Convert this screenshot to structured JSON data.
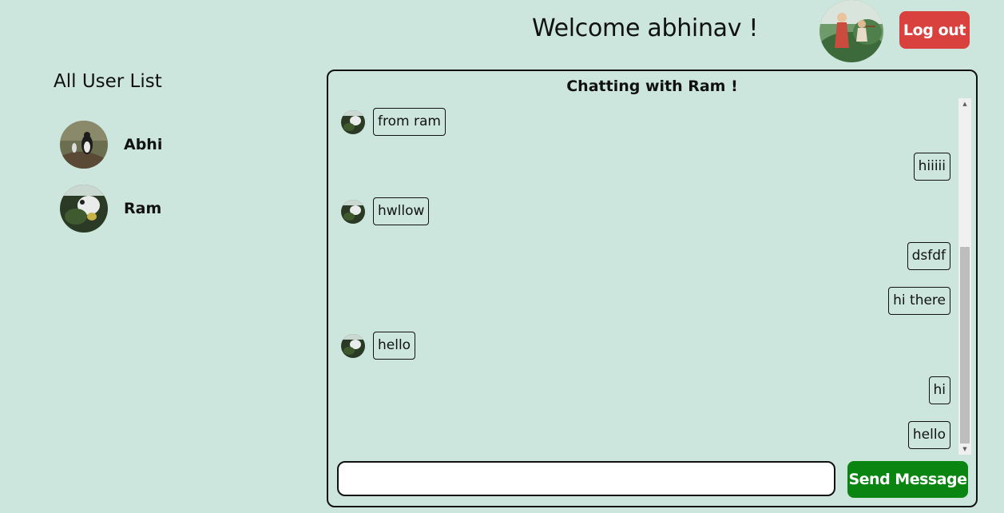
{
  "header": {
    "welcome_text": "Welcome abhinav !",
    "logout_label": "Log out"
  },
  "sidebar": {
    "title": "All User List",
    "users": [
      {
        "name": "Abhi"
      },
      {
        "name": "Ram"
      }
    ]
  },
  "chat": {
    "title": "Chatting with Ram !",
    "messages": [
      {
        "side": "left",
        "text": "from ram"
      },
      {
        "side": "right",
        "text": "hiiiii"
      },
      {
        "side": "left",
        "text": "hwllow"
      },
      {
        "side": "right",
        "text": "dsfdf"
      },
      {
        "side": "right",
        "text": "hi there"
      },
      {
        "side": "left",
        "text": "hello"
      },
      {
        "side": "right",
        "text": "hi"
      },
      {
        "side": "right",
        "text": "hello"
      }
    ],
    "input_value": "",
    "send_label": "Send Message"
  },
  "colors": {
    "background": "#cce6de",
    "logout": "#d9413f",
    "send": "#0a8512"
  }
}
